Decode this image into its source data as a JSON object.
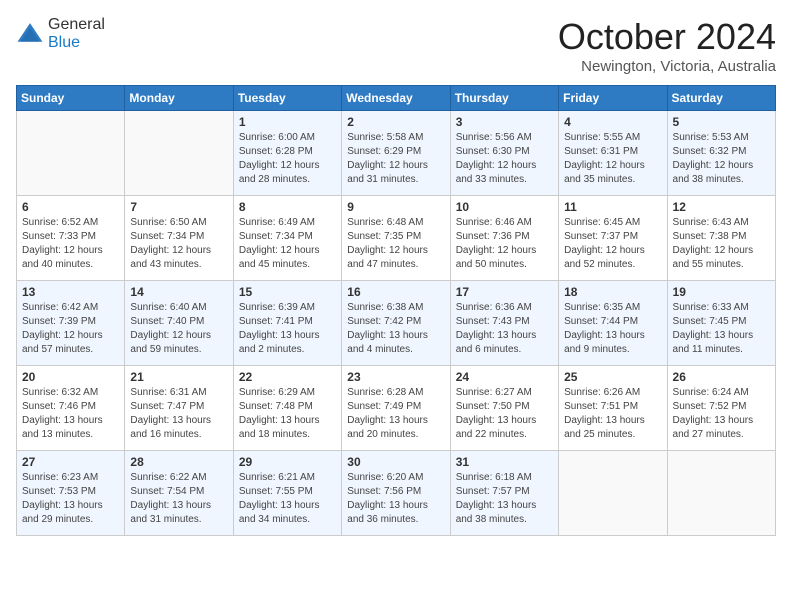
{
  "logo": {
    "general": "General",
    "blue": "Blue"
  },
  "header": {
    "month": "October 2024",
    "location": "Newington, Victoria, Australia"
  },
  "weekdays": [
    "Sunday",
    "Monday",
    "Tuesday",
    "Wednesday",
    "Thursday",
    "Friday",
    "Saturday"
  ],
  "weeks": [
    [
      {
        "day": "",
        "info": ""
      },
      {
        "day": "",
        "info": ""
      },
      {
        "day": "1",
        "info": "Sunrise: 6:00 AM\nSunset: 6:28 PM\nDaylight: 12 hours\nand 28 minutes."
      },
      {
        "day": "2",
        "info": "Sunrise: 5:58 AM\nSunset: 6:29 PM\nDaylight: 12 hours\nand 31 minutes."
      },
      {
        "day": "3",
        "info": "Sunrise: 5:56 AM\nSunset: 6:30 PM\nDaylight: 12 hours\nand 33 minutes."
      },
      {
        "day": "4",
        "info": "Sunrise: 5:55 AM\nSunset: 6:31 PM\nDaylight: 12 hours\nand 35 minutes."
      },
      {
        "day": "5",
        "info": "Sunrise: 5:53 AM\nSunset: 6:32 PM\nDaylight: 12 hours\nand 38 minutes."
      }
    ],
    [
      {
        "day": "6",
        "info": "Sunrise: 6:52 AM\nSunset: 7:33 PM\nDaylight: 12 hours\nand 40 minutes."
      },
      {
        "day": "7",
        "info": "Sunrise: 6:50 AM\nSunset: 7:34 PM\nDaylight: 12 hours\nand 43 minutes."
      },
      {
        "day": "8",
        "info": "Sunrise: 6:49 AM\nSunset: 7:34 PM\nDaylight: 12 hours\nand 45 minutes."
      },
      {
        "day": "9",
        "info": "Sunrise: 6:48 AM\nSunset: 7:35 PM\nDaylight: 12 hours\nand 47 minutes."
      },
      {
        "day": "10",
        "info": "Sunrise: 6:46 AM\nSunset: 7:36 PM\nDaylight: 12 hours\nand 50 minutes."
      },
      {
        "day": "11",
        "info": "Sunrise: 6:45 AM\nSunset: 7:37 PM\nDaylight: 12 hours\nand 52 minutes."
      },
      {
        "day": "12",
        "info": "Sunrise: 6:43 AM\nSunset: 7:38 PM\nDaylight: 12 hours\nand 55 minutes."
      }
    ],
    [
      {
        "day": "13",
        "info": "Sunrise: 6:42 AM\nSunset: 7:39 PM\nDaylight: 12 hours\nand 57 minutes."
      },
      {
        "day": "14",
        "info": "Sunrise: 6:40 AM\nSunset: 7:40 PM\nDaylight: 12 hours\nand 59 minutes."
      },
      {
        "day": "15",
        "info": "Sunrise: 6:39 AM\nSunset: 7:41 PM\nDaylight: 13 hours\nand 2 minutes."
      },
      {
        "day": "16",
        "info": "Sunrise: 6:38 AM\nSunset: 7:42 PM\nDaylight: 13 hours\nand 4 minutes."
      },
      {
        "day": "17",
        "info": "Sunrise: 6:36 AM\nSunset: 7:43 PM\nDaylight: 13 hours\nand 6 minutes."
      },
      {
        "day": "18",
        "info": "Sunrise: 6:35 AM\nSunset: 7:44 PM\nDaylight: 13 hours\nand 9 minutes."
      },
      {
        "day": "19",
        "info": "Sunrise: 6:33 AM\nSunset: 7:45 PM\nDaylight: 13 hours\nand 11 minutes."
      }
    ],
    [
      {
        "day": "20",
        "info": "Sunrise: 6:32 AM\nSunset: 7:46 PM\nDaylight: 13 hours\nand 13 minutes."
      },
      {
        "day": "21",
        "info": "Sunrise: 6:31 AM\nSunset: 7:47 PM\nDaylight: 13 hours\nand 16 minutes."
      },
      {
        "day": "22",
        "info": "Sunrise: 6:29 AM\nSunset: 7:48 PM\nDaylight: 13 hours\nand 18 minutes."
      },
      {
        "day": "23",
        "info": "Sunrise: 6:28 AM\nSunset: 7:49 PM\nDaylight: 13 hours\nand 20 minutes."
      },
      {
        "day": "24",
        "info": "Sunrise: 6:27 AM\nSunset: 7:50 PM\nDaylight: 13 hours\nand 22 minutes."
      },
      {
        "day": "25",
        "info": "Sunrise: 6:26 AM\nSunset: 7:51 PM\nDaylight: 13 hours\nand 25 minutes."
      },
      {
        "day": "26",
        "info": "Sunrise: 6:24 AM\nSunset: 7:52 PM\nDaylight: 13 hours\nand 27 minutes."
      }
    ],
    [
      {
        "day": "27",
        "info": "Sunrise: 6:23 AM\nSunset: 7:53 PM\nDaylight: 13 hours\nand 29 minutes."
      },
      {
        "day": "28",
        "info": "Sunrise: 6:22 AM\nSunset: 7:54 PM\nDaylight: 13 hours\nand 31 minutes."
      },
      {
        "day": "29",
        "info": "Sunrise: 6:21 AM\nSunset: 7:55 PM\nDaylight: 13 hours\nand 34 minutes."
      },
      {
        "day": "30",
        "info": "Sunrise: 6:20 AM\nSunset: 7:56 PM\nDaylight: 13 hours\nand 36 minutes."
      },
      {
        "day": "31",
        "info": "Sunrise: 6:18 AM\nSunset: 7:57 PM\nDaylight: 13 hours\nand 38 minutes."
      },
      {
        "day": "",
        "info": ""
      },
      {
        "day": "",
        "info": ""
      }
    ]
  ]
}
